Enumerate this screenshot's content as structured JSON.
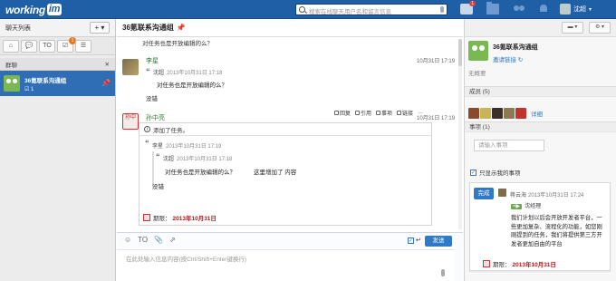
{
  "topbar": {
    "logo_text": "working",
    "logo_box": "im",
    "search_placeholder": "搜索在线聊天用户名和留言信息",
    "task_badge": "1",
    "user_name": "沈超",
    "caret": "▾"
  },
  "left": {
    "title": "聊天列表",
    "add": "+ ▾",
    "tabs": [
      {
        "label": "⌂"
      },
      {
        "label": "💬"
      },
      {
        "label": "TO"
      },
      {
        "label": "☑",
        "badge": "1"
      },
      {
        "label": "☰"
      }
    ],
    "section": "群聊",
    "section_close": "✕",
    "item_name": "36氪联系沟通组",
    "item_sub": "☑ 1",
    "item_pin": "📌"
  },
  "center": {
    "title": "36氪联系沟通组",
    "pin": "📌",
    "snip_top": "对任务也是开放编辑的么？",
    "msg1": {
      "name": "李星",
      "date": "10月31日 17:19",
      "quote_user": "沈超",
      "quote_date": "2013年10月31日 17:18",
      "quote_text": "对任务也是开放编辑的么？",
      "reply": "没错"
    },
    "toolbar": {
      "reply": "回复",
      "quote": "引用",
      "task": "事项",
      "link": "链接",
      "more": "···"
    },
    "msg2": {
      "avatar_text": "孙中",
      "name": "孙中亮",
      "date": "10月31日 17:19",
      "header": "添加了任务。",
      "inner_user": "李星",
      "inner_date": "2013年10月31日 17:19",
      "inner_quote_user": "沈超",
      "inner_quote_date": "2013年10月31日 17:18",
      "inner_quote_text": "对任务也是开放编辑的么？",
      "inner_note": "这里增加了 内容",
      "inner_reply": "没错",
      "deadline_label": "期限：",
      "deadline_date": "2013年10月31日"
    },
    "compose": {
      "tools": [
        "☺",
        "TO",
        "📎",
        "⇗"
      ],
      "check": "✓",
      "enter": "↵",
      "send": "发送",
      "placeholder": "在此处输入信息内容(按Ctrl/Shift+Enter键换行)"
    }
  },
  "right": {
    "btn_folder": "▬ ▾",
    "btn_gear": "⚙ ▾",
    "group_name": "36氪联系沟通组",
    "invite": "邀请链接 ↻",
    "desc": "无概要",
    "members_title": "成员 (5)",
    "members_detail": "详细",
    "member_colors": [
      "#8a4b2a",
      "#c9b45a",
      "#3c2f27",
      "#8c7a52",
      "#c0342c"
    ],
    "tasks_title": "事项 (1)",
    "task_search": "请输入事项",
    "only_mine": "只显示我的事项",
    "task": {
      "done": "完成",
      "creator": "蒋云海",
      "date": "2013年10月31日 17:24",
      "tag": "=▶",
      "assignee": "沈经理",
      "body": "我们计划以后会开放开发者平台，一些更加复杂、流程化的功能，如您刚刚提到的任务，我们将提供第三方开发者更加自由的平台",
      "deadline_label": "期限：",
      "deadline_date": "2013年10月31日"
    }
  }
}
